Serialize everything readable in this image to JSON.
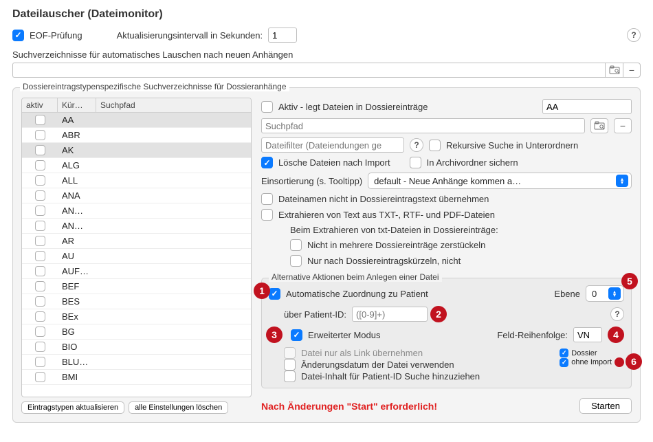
{
  "title": "Dateilauscher (Dateimonitor)",
  "top": {
    "eof_label": "EOF-Prüfung",
    "interval_label": "Aktualisierungsintervall in Sekunden:",
    "interval_value": "1",
    "search_dirs_label": "Suchverzeichnisse für automatisches Lauschen nach neuen Anhängen"
  },
  "group_label": "Dossiereintragstypenspezifische Suchverzeichnisse für Dossieranhänge",
  "table": {
    "headers": {
      "aktiv": "aktiv",
      "kurz": "Kür…",
      "pfad": "Suchpfad"
    },
    "rows": [
      {
        "k": "AA",
        "sel": true
      },
      {
        "k": "ABR"
      },
      {
        "k": "AK",
        "sel": true
      },
      {
        "k": "ALG"
      },
      {
        "k": "ALL"
      },
      {
        "k": "ANA"
      },
      {
        "k": "AN…"
      },
      {
        "k": "AN…"
      },
      {
        "k": "AR"
      },
      {
        "k": "AU"
      },
      {
        "k": "AUF…"
      },
      {
        "k": "BEF"
      },
      {
        "k": "BES"
      },
      {
        "k": "BEx"
      },
      {
        "k": "BG"
      },
      {
        "k": "BIO"
      },
      {
        "k": "BLU…"
      },
      {
        "k": "BMI"
      }
    ],
    "refresh_btn": "Eintragstypen aktualisieren",
    "clear_btn": "alle Einstellungen löschen"
  },
  "right": {
    "aktiv_label": "Aktiv - legt Dateien in Dossiereinträge",
    "aktiv_value": "AA",
    "suchpfad_placeholder": "Suchpfad",
    "filter_placeholder": "Dateifilter (Dateiendungen ge",
    "recursive_label": "Rekursive Suche in Unterordnern",
    "delete_label": "Lösche Dateien nach Import",
    "archive_label": "In Archivordner sichern",
    "sort_label": "Einsortierung (s. Tooltipp)",
    "sort_value": "default - Neue Anhänge kommen a…",
    "no_filename_label": "Dateinamen nicht in Dossiereintragstext übernehmen",
    "extract_label": "Extrahieren von Text aus TXT-, RTF- und PDF-Dateien",
    "extract_sub_label": "Beim Extrahieren von txt-Dateien in Dossiereinträge:",
    "no_split_label": "Nicht in mehrere Dossiereinträge zerstückeln",
    "only_shortcuts_label": "Nur nach Dossiereintragskürzeln, nicht",
    "alt_actions_label": "Alternative Aktionen beim Anlegen einer Datei",
    "auto_assign_label": "Automatische Zuordnung zu Patient",
    "ebene_label": "Ebene",
    "ebene_value": "0",
    "patient_id_label": "über Patient-ID:",
    "patient_id_placeholder": "([0-9]+)",
    "extended_label": "Erweiterter Modus",
    "field_order_label": "Feld-Reihenfolge:",
    "field_order_value": "VN",
    "link_only_label": "Datei nur als Link übernehmen",
    "mod_date_label": "Änderungsdatum der Datei verwenden",
    "content_search_label": "Datei-Inhalt für Patient-ID Suche hinzuziehen",
    "dossier_label": "Dossier",
    "ohne_import_label": "ohne Import",
    "note": "Nach Änderungen \"Start\" erforderlich!",
    "start_btn": "Starten"
  },
  "badges": [
    "1",
    "2",
    "3",
    "4",
    "5",
    "6"
  ]
}
